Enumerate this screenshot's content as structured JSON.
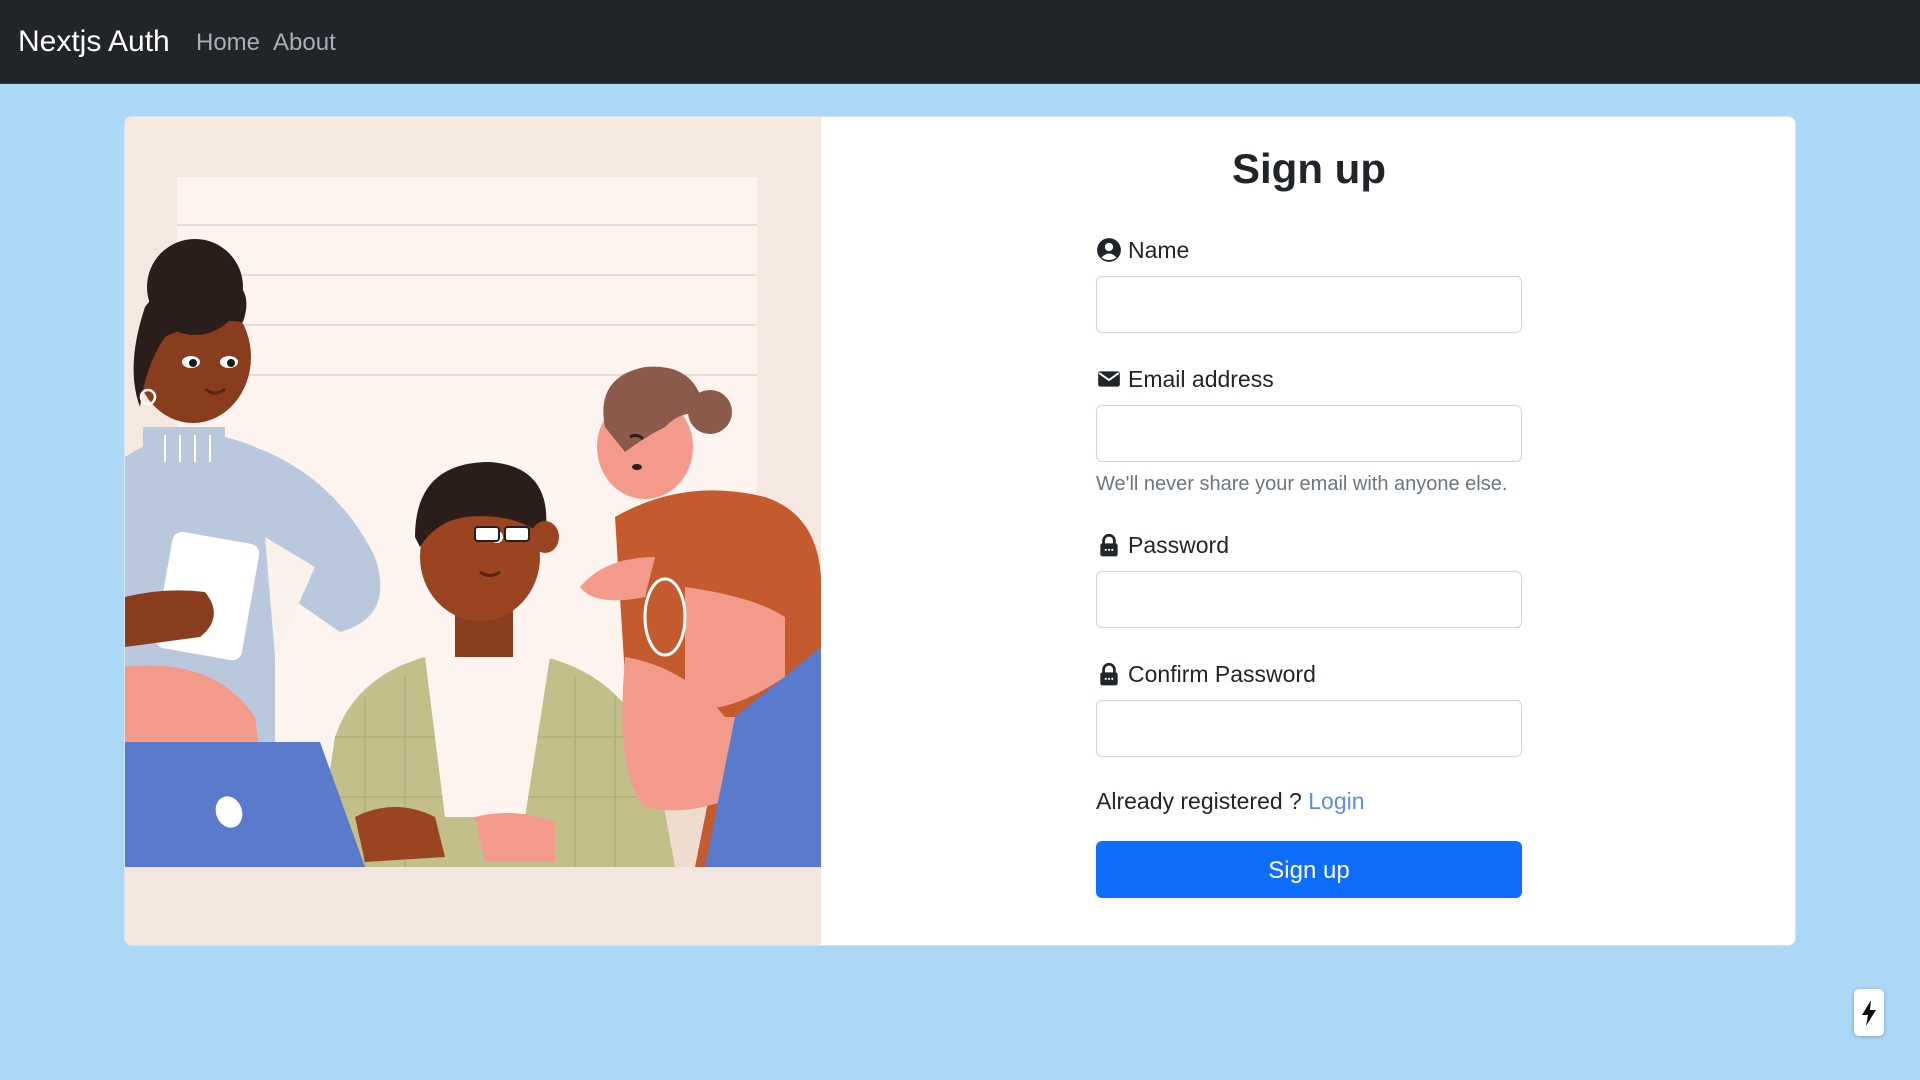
{
  "navbar": {
    "brand": "Nextjs Auth",
    "links": [
      {
        "label": "Home"
      },
      {
        "label": "About"
      }
    ]
  },
  "form": {
    "title": "Sign up",
    "fields": {
      "name": {
        "label": "Name",
        "icon": "user-circle-icon",
        "value": "",
        "placeholder": ""
      },
      "email": {
        "label": "Email address",
        "icon": "envelope-icon",
        "value": "",
        "placeholder": "",
        "help": "We'll never share your email with anyone else."
      },
      "password": {
        "label": "Password",
        "icon": "lock-icon",
        "value": "",
        "placeholder": ""
      },
      "confirm_password": {
        "label": "Confirm Password",
        "icon": "lock-icon",
        "value": "",
        "placeholder": ""
      }
    },
    "already_registered": "Already registered ? ",
    "login_link": "Login",
    "submit_label": "Sign up"
  },
  "widget": {
    "icon": "lightning-bolt-icon"
  },
  "colors": {
    "page_background": "#acd8f7",
    "navbar_background": "#212529",
    "primary_button": "#0d6efd",
    "link": "#5c8de8"
  }
}
